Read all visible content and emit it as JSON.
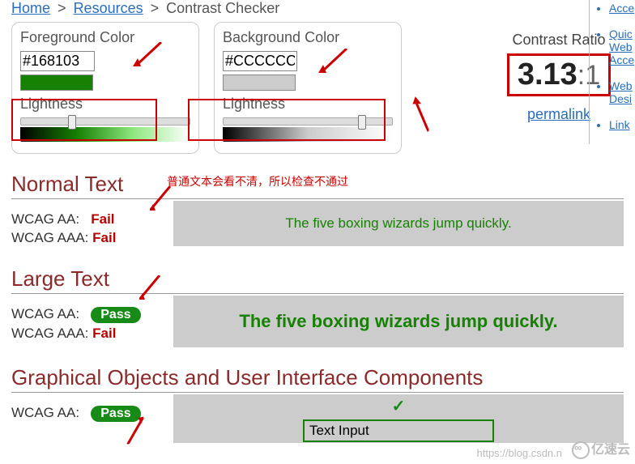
{
  "breadcrumb": {
    "home": "Home",
    "resources": "Resources",
    "current": "Contrast Checker"
  },
  "foreground": {
    "title": "Foreground Color",
    "hex": "#168103",
    "lightness_label": "Lightness"
  },
  "background": {
    "title": "Background Color",
    "hex": "#CCCCCC",
    "lightness_label": "Lightness"
  },
  "ratio": {
    "title": "Contrast Ratio",
    "value": "3.13",
    "suffix": ":1",
    "permalink": "permalink"
  },
  "annotation_cn": "普通文本会看不清，所以检查不通过",
  "normal": {
    "heading": "Normal Text",
    "aa_label": "WCAG AA:",
    "aa_result": "Fail",
    "aaa_label": "WCAG AAA:",
    "aaa_result": "Fail",
    "sample": "The five boxing wizards jump quickly."
  },
  "large": {
    "heading": "Large Text",
    "aa_label": "WCAG AA:",
    "aa_result": "Pass",
    "aaa_label": "WCAG AAA:",
    "aaa_result": "Fail",
    "sample": "The five boxing wizards jump quickly."
  },
  "gui": {
    "heading": "Graphical Objects and User Interface Components",
    "aa_label": "WCAG AA:",
    "aa_result": "Pass",
    "check": "✓",
    "input_value": "Text Input"
  },
  "right_nav": {
    "items": [
      "Acce",
      "Quic Web Acce",
      "Web Desi",
      "Link"
    ]
  },
  "watermark1": "https://blog.csdn.n",
  "watermark2": "亿速云"
}
